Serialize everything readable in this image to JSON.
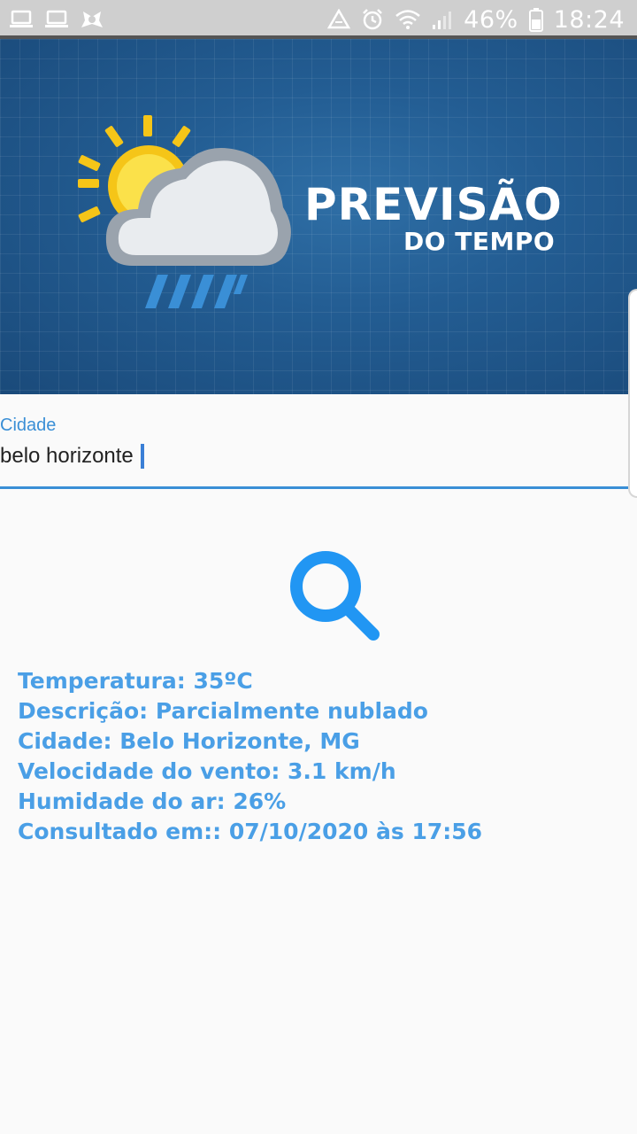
{
  "status_bar": {
    "battery": "46%",
    "time": "18:24",
    "icons": [
      "laptop-icon",
      "laptop-icon",
      "vpn-shield-icon",
      "recycle-icon",
      "alarm-icon",
      "wifi-icon",
      "signal-icon",
      "battery-icon"
    ]
  },
  "banner": {
    "title": "PREVISÃO",
    "subtitle": "DO TEMPO",
    "art": "sun-cloud-rain-icon"
  },
  "city_field": {
    "label": "Cidade",
    "value": "belo horizonte"
  },
  "search_button": {
    "icon": "search-icon"
  },
  "results": {
    "temperature": "Temperatura: 35ºC",
    "description": "Descrição: Parcialmente nublado",
    "city": "Cidade: Belo Horizonte, MG",
    "wind": "Velocidade do vento: 3.1 km/h",
    "humidity": "Humidade do ar: 26%",
    "consulted": "Consultado em:: 07/10/2020 às 17:56"
  },
  "colors": {
    "accent": "#3a8fd6",
    "result_text": "#4a9fe6",
    "banner_bg": "#235d93",
    "status_bar_bg": "#cfcfcf"
  }
}
